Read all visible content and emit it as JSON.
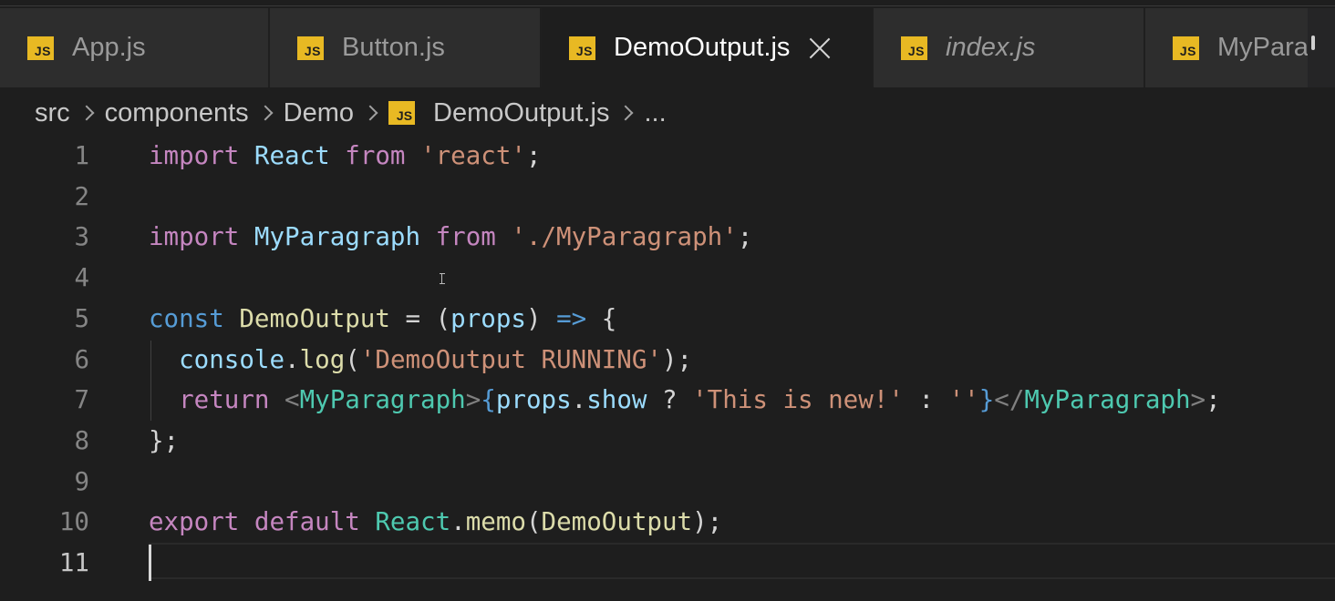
{
  "tabs": [
    {
      "label": "App.js",
      "badge": "JS",
      "active": false
    },
    {
      "label": "Button.js",
      "badge": "JS",
      "active": false
    },
    {
      "label": "DemoOutput.js",
      "badge": "JS",
      "active": true
    },
    {
      "label": "index.js",
      "badge": "JS",
      "active": false
    },
    {
      "label": "MyPara",
      "badge": "JS",
      "active": false
    }
  ],
  "breadcrumb": {
    "items": [
      "src",
      "components",
      "Demo",
      "DemoOutput.js",
      "..."
    ],
    "file_badge": "JS"
  },
  "editor": {
    "line_numbers": [
      "1",
      "2",
      "3",
      "4",
      "5",
      "6",
      "7",
      "8",
      "9",
      "10",
      "11"
    ],
    "current_line": "11",
    "lines": [
      [
        [
          "kw",
          "import"
        ],
        [
          "pun",
          " "
        ],
        [
          "id",
          "React"
        ],
        [
          "pun",
          " "
        ],
        [
          "kw",
          "from"
        ],
        [
          "pun",
          " "
        ],
        [
          "str",
          "'react'"
        ],
        [
          "pun",
          ";"
        ]
      ],
      [],
      [
        [
          "kw",
          "import"
        ],
        [
          "pun",
          " "
        ],
        [
          "id",
          "MyParagraph"
        ],
        [
          "pun",
          " "
        ],
        [
          "kw",
          "from"
        ],
        [
          "pun",
          " "
        ],
        [
          "str",
          "'./MyParagraph'"
        ],
        [
          "pun",
          ";"
        ]
      ],
      [],
      [
        [
          "kw2",
          "const"
        ],
        [
          "pun",
          " "
        ],
        [
          "fn",
          "DemoOutput"
        ],
        [
          "pun",
          " = ("
        ],
        [
          "id",
          "props"
        ],
        [
          "pun",
          ") "
        ],
        [
          "kw2",
          "=>"
        ],
        [
          "pun",
          " {"
        ]
      ],
      [
        [
          "pun",
          "  "
        ],
        [
          "id",
          "console"
        ],
        [
          "pun",
          "."
        ],
        [
          "fn",
          "log"
        ],
        [
          "pun",
          "("
        ],
        [
          "str",
          "'DemoOutput RUNNING'"
        ],
        [
          "pun",
          ");"
        ]
      ],
      [
        [
          "pun",
          "  "
        ],
        [
          "kw",
          "return"
        ],
        [
          "pun",
          " "
        ],
        [
          "tagb",
          "<"
        ],
        [
          "cls",
          "MyParagraph"
        ],
        [
          "tagb",
          ">"
        ],
        [
          "brace",
          "{"
        ],
        [
          "id",
          "props"
        ],
        [
          "pun",
          "."
        ],
        [
          "id",
          "show"
        ],
        [
          "pun",
          " ? "
        ],
        [
          "str",
          "'This is new!'"
        ],
        [
          "pun",
          " : "
        ],
        [
          "str",
          "''"
        ],
        [
          "brace",
          "}"
        ],
        [
          "tagb",
          "</"
        ],
        [
          "cls",
          "MyParagraph"
        ],
        [
          "tagb",
          ">"
        ],
        [
          "pun",
          ";"
        ]
      ],
      [
        [
          "pun",
          "};"
        ]
      ],
      [],
      [
        [
          "kw",
          "export"
        ],
        [
          "pun",
          " "
        ],
        [
          "kw",
          "default"
        ],
        [
          "pun",
          " "
        ],
        [
          "cls",
          "React"
        ],
        [
          "pun",
          "."
        ],
        [
          "fn",
          "memo"
        ],
        [
          "pun",
          "("
        ],
        [
          "fn",
          "DemoOutput"
        ],
        [
          "pun",
          ");"
        ]
      ],
      []
    ]
  },
  "colors": {
    "accent_js": "#e8b923",
    "background": "#1e1e1e"
  }
}
